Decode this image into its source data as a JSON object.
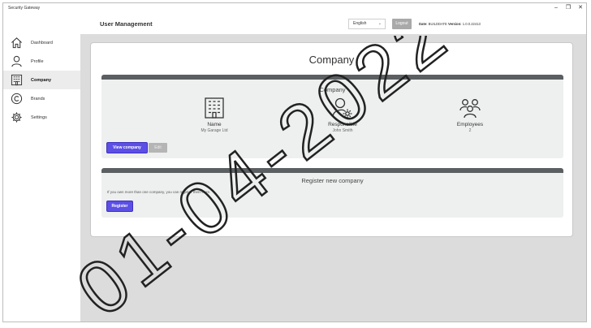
{
  "app": {
    "title": "Security Gateway"
  },
  "window_controls": {
    "minimize": "–",
    "maximize": "❐",
    "close": "✕"
  },
  "sidebar": {
    "items": [
      {
        "label": "Dashboard",
        "icon": "home-icon",
        "active": false
      },
      {
        "label": "Profile",
        "icon": "user-icon",
        "active": false
      },
      {
        "label": "Company",
        "icon": "building-icon",
        "active": true
      },
      {
        "label": "Brands",
        "icon": "copyright-icon",
        "active": false
      },
      {
        "label": "Settings",
        "icon": "gear-icon",
        "active": false
      }
    ]
  },
  "header": {
    "title": "User Management",
    "language": "English",
    "logout_label": "Logout",
    "date_label": "Date:",
    "date_value": "BUILDDATE",
    "version_label": "Version:",
    "version_value": "1.0.0.22413"
  },
  "company_card": {
    "title": "Company",
    "panel_title": "Company",
    "stats": [
      {
        "label": "Name",
        "value": "My Garage Ltd",
        "icon": "building-icon"
      },
      {
        "label": "Responsible",
        "value": "John Smith",
        "icon": "user-gear-icon"
      },
      {
        "label": "Employees",
        "value": "2",
        "icon": "users-group-icon"
      }
    ],
    "view_button": "View company",
    "edit_button": "Edit"
  },
  "register_panel": {
    "title": "Register new company",
    "text": "If you own more than one company, you can register them here.",
    "register_button": "Register"
  },
  "watermark": {
    "text": "01-04-2022"
  },
  "colors": {
    "accent": "#5c4fe6",
    "panel_bar": "#5b5f61",
    "content_bg": "#dcdcdc"
  }
}
